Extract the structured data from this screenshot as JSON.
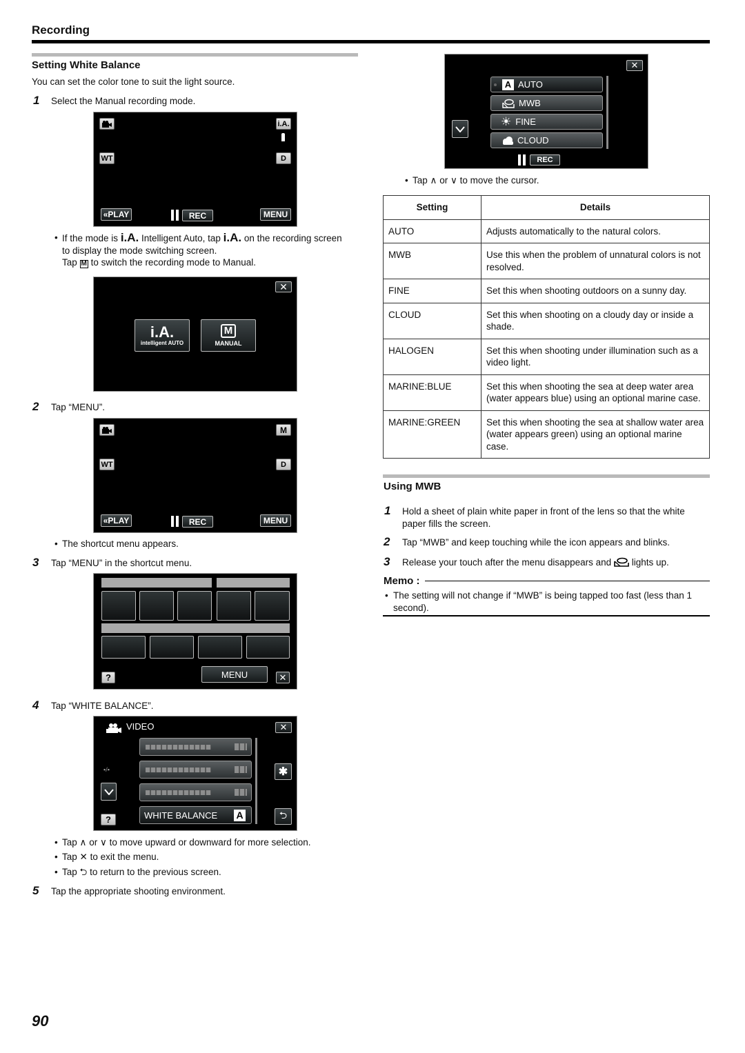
{
  "page": {
    "header": "Recording",
    "page_number": "90"
  },
  "left": {
    "section_title": "Setting White Balance",
    "intro": "You can set the color tone to suit the light source.",
    "steps": [
      {
        "num": "1",
        "text": "Select the Manual recording mode."
      },
      {
        "num": "2",
        "text": "Tap “MENU”."
      },
      {
        "num": "3",
        "text": "Tap “MENU” in the shortcut menu."
      },
      {
        "num": "4",
        "text": "Tap “WHITE BALANCE”."
      },
      {
        "num": "5",
        "text": "Tap the appropriate shooting environment."
      }
    ],
    "step1_note": {
      "part1": "If the mode is",
      "ia_glyph": "i.A.",
      "part2": "Intelligent Auto, tap",
      "part3": "on the recording screen",
      "line2": "to display the mode switching screen.",
      "line3_pre": "Tap",
      "m_glyph": "M",
      "line3_post": "to switch the recording mode to Manual."
    },
    "step2_note": "The shortcut menu appears.",
    "step4_notes": [
      {
        "pre": "Tap",
        "icon1": "∧",
        "mid": "or",
        "icon2": "∨",
        "post": "to move upward or downward for more selection."
      },
      {
        "pre": "Tap",
        "icon1": "✕",
        "post": "to exit the menu."
      },
      {
        "pre": "Tap",
        "icon1": "⮌",
        "post": "to return to the previous screen."
      }
    ]
  },
  "screens": {
    "rec_screen_ia": {
      "mode_badge": "i.A.",
      "wt": "WT",
      "d": "D",
      "play": "«PLAY",
      "rec": "REC",
      "menu": "MENU"
    },
    "mode_switch": {
      "ia_big": "i.A.",
      "ia_label": "intelligent AUTO",
      "m_big": "M",
      "m_label": "MANUAL"
    },
    "rec_screen_m": {
      "mode_badge": "M",
      "wt": "WT",
      "d": "D",
      "play": "«PLAY",
      "rec": "REC",
      "menu": "MENU"
    },
    "shortcut_menu": {
      "menu_button": "MENU",
      "help": "?"
    },
    "video_menu": {
      "title": "VIDEO",
      "page_indicator": "▪/▪",
      "selected_item": "WHITE BALANCE",
      "selected_value": "A",
      "help": "?"
    },
    "wb_menu": {
      "items": [
        {
          "icon": "A",
          "label": "AUTO",
          "selected": true
        },
        {
          "icon": "mwb",
          "label": "MWB",
          "selected": false
        },
        {
          "icon": "sun",
          "label": "FINE",
          "selected": false
        },
        {
          "icon": "cloud",
          "label": "CLOUD",
          "selected": false
        }
      ],
      "rec": "REC"
    }
  },
  "right": {
    "cursor_note": {
      "pre": "Tap",
      "icon1": "∧",
      "mid": "or",
      "icon2": "∨",
      "post": "to move the cursor."
    },
    "table": {
      "headers": [
        "Setting",
        "Details"
      ],
      "rows": [
        {
          "setting": "AUTO",
          "details": "Adjusts automatically to the natural colors."
        },
        {
          "setting": "MWB",
          "details": "Use this when the problem of unnatural colors is not resolved."
        },
        {
          "setting": "FINE",
          "details": "Set this when shooting outdoors on a sunny day."
        },
        {
          "setting": "CLOUD",
          "details": "Set this when shooting on a cloudy day or inside a shade."
        },
        {
          "setting": "HALOGEN",
          "details": "Set this when shooting under illumination such as a video light."
        },
        {
          "setting": "MARINE:BLUE",
          "details": "Set this when shooting the sea at deep water area (water appears blue) using an optional marine case."
        },
        {
          "setting": "MARINE:GREEN",
          "details": "Set this when shooting the sea at shallow water area (water appears green) using an optional marine case."
        }
      ]
    },
    "mwb_section": {
      "title": "Using MWB",
      "steps": [
        {
          "num": "1",
          "text": "Hold a sheet of plain white paper in front of the lens so that the white paper fills the screen."
        },
        {
          "num": "2",
          "text": "Tap “MWB” and keep touching while the icon appears and blinks."
        },
        {
          "num": "3",
          "pre": "Release your touch after the menu disappears and",
          "post": "lights up."
        }
      ]
    },
    "memo": {
      "title": "Memo :",
      "items": [
        "The setting will not change if “MWB” is being tapped too fast (less than 1 second)."
      ]
    }
  }
}
